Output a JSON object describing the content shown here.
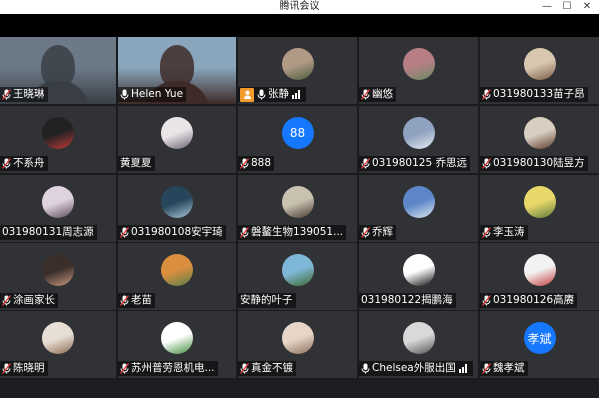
{
  "window": {
    "title": "腾讯会议",
    "minimize": "—",
    "maximize": "☐",
    "close": "✕"
  },
  "accent": "#2fb673",
  "tiles": [
    {
      "name": "王晓琳",
      "mic": "muted",
      "kind": "video",
      "palette": [
        "#6c7a88",
        "#3a3f46"
      ]
    },
    {
      "name": "Helen Yue",
      "mic": "on",
      "kind": "video",
      "palette": [
        "#8aa6bd",
        "#3e2b29"
      ],
      "active": true
    },
    {
      "name": "张静",
      "mic": "on",
      "kind": "avatar",
      "palette": [
        "#b09a86",
        "#4a5b3e"
      ],
      "host": true,
      "signal": true
    },
    {
      "name": "幽悠",
      "mic": "muted",
      "kind": "avatar",
      "palette": [
        "#b77f84",
        "#6a8a66"
      ]
    },
    {
      "name": "031980133苗子昂",
      "mic": "muted",
      "kind": "avatar",
      "palette": [
        "#d8c8b0",
        "#7a5b47"
      ]
    },
    {
      "name": "不系舟",
      "mic": "muted",
      "kind": "avatar",
      "palette": [
        "#222222",
        "#c23a3a"
      ]
    },
    {
      "name": "黄夏夏",
      "mic": "none",
      "kind": "avatar",
      "palette": [
        "#e9e4e6",
        "#6b6475"
      ]
    },
    {
      "name": "888",
      "mic": "muted",
      "kind": "text",
      "text": "88",
      "palette": [
        "#1677ff",
        "#1677ff"
      ]
    },
    {
      "name": "031980125 乔思远",
      "mic": "muted",
      "kind": "avatar",
      "palette": [
        "#8fa2c0",
        "#e6ebf2"
      ]
    },
    {
      "name": "031980130陆昱方",
      "mic": "muted",
      "kind": "avatar",
      "palette": [
        "#d9cfc1",
        "#5b3a2c"
      ]
    },
    {
      "name": "031980131周志源",
      "mic": "none",
      "kind": "avatar",
      "palette": [
        "#e0d3e0",
        "#5a4a5c"
      ]
    },
    {
      "name": "031980108安宇琦",
      "mic": "muted",
      "kind": "avatar",
      "palette": [
        "#27455b",
        "#a9c7d6"
      ]
    },
    {
      "name": "磐鳌生物139051...",
      "mic": "muted",
      "kind": "avatar",
      "palette": [
        "#c9c2b0",
        "#4a3a30"
      ]
    },
    {
      "name": "乔辉",
      "mic": "muted",
      "kind": "avatar",
      "palette": [
        "#5c86c8",
        "#dfe7ef"
      ]
    },
    {
      "name": "李玉涛",
      "mic": "muted",
      "kind": "avatar",
      "palette": [
        "#e8d86a",
        "#5f7a3c"
      ]
    },
    {
      "name": "涂画家长",
      "mic": "muted",
      "kind": "avatar",
      "palette": [
        "#3a2e2a",
        "#c79b7f"
      ]
    },
    {
      "name": "老苗",
      "mic": "muted",
      "kind": "avatar",
      "palette": [
        "#d98f3e",
        "#5b7f49"
      ]
    },
    {
      "name": "安静的叶子",
      "mic": "none",
      "kind": "avatar",
      "palette": [
        "#7fb7d9",
        "#3d6a2d"
      ]
    },
    {
      "name": "031980122揭鹏海",
      "mic": "none",
      "kind": "avatar",
      "palette": [
        "#ffffff",
        "#111111"
      ]
    },
    {
      "name": "031980126高赓",
      "mic": "muted",
      "kind": "avatar",
      "palette": [
        "#f2f2f2",
        "#c43b3b"
      ]
    },
    {
      "name": "陈晓明",
      "mic": "muted",
      "kind": "avatar",
      "palette": [
        "#e7dfd5",
        "#8d6b52"
      ]
    },
    {
      "name": "苏州普劳恩机电...",
      "mic": "muted",
      "kind": "avatar",
      "palette": [
        "#ffffff",
        "#3f8b3a"
      ]
    },
    {
      "name": "真金不镀",
      "mic": "muted",
      "kind": "avatar",
      "palette": [
        "#e7d6c7",
        "#8c6e5b"
      ]
    },
    {
      "name": "Chelsea外服出国",
      "mic": "on",
      "kind": "avatar",
      "palette": [
        "#d9d9d9",
        "#555555"
      ],
      "signal": true
    },
    {
      "name": "魏孝斌",
      "mic": "muted",
      "kind": "text",
      "text": "孝斌",
      "palette": [
        "#1677ff",
        "#1677ff"
      ]
    }
  ]
}
